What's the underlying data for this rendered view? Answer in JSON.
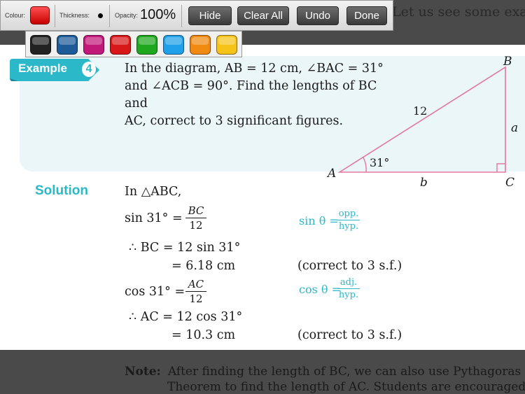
{
  "toolbar": {
    "colour_label": "Colour:",
    "thickness_label": "Thickness:",
    "opacity_label": "Opacity:",
    "opacity_value": "100%",
    "hide_label": "Hide",
    "clear_all_label": "Clear All",
    "undo_label": "Undo",
    "done_label": "Done",
    "selected_colour": "#e00000"
  },
  "palette": [
    {
      "name": "black",
      "color": "#222222"
    },
    {
      "name": "blue",
      "color": "#1d5a98"
    },
    {
      "name": "magenta",
      "color": "#c2187a"
    },
    {
      "name": "red",
      "color": "#d81818"
    },
    {
      "name": "green",
      "color": "#1fa81f"
    },
    {
      "name": "light-blue",
      "color": "#1fa0e8"
    },
    {
      "name": "orange",
      "color": "#f08a10"
    },
    {
      "name": "yellow",
      "color": "#f6c418"
    }
  ],
  "background_text": "Let us see some example",
  "example": {
    "label": "Example",
    "number": "4",
    "line1": "In the diagram, AB = 12 cm, ∠BAC = 31°",
    "line2": "and ∠ACB = 90°. Find the lengths of BC and",
    "line3": "AC, correct to 3 significant figures."
  },
  "diagram": {
    "vertex_a": "A",
    "vertex_b": "B",
    "vertex_c": "C",
    "side_ab": "12",
    "side_bc": "a",
    "side_ac": "b",
    "angle": "31°",
    "line_color": "#e2789e"
  },
  "solution": {
    "label": "Solution",
    "line0": "In △ABC,",
    "sin_lhs": "sin 31° =",
    "sin_num": "BC",
    "sin_den": "12",
    "bc_line": "∴  BC = 12 sin 31°",
    "bc_result": "= 6.18 cm",
    "bc_note": "(correct to 3 s.f.)",
    "cos_lhs": "cos 31° =",
    "cos_num": "AC",
    "cos_den": "12",
    "ac_line": "∴  AC = 12 cos 31°",
    "ac_result": "= 10.3 cm",
    "ac_note": "(correct to 3 s.f.)",
    "hint_sin": "sin θ =",
    "hint_sin_num": "opp.",
    "hint_sin_den": "hyp.",
    "hint_cos": "cos θ =",
    "hint_cos_num": "adj.",
    "hint_cos_den": "hyp."
  },
  "note": {
    "label": "Note:",
    "line1": "After finding the length of BC, we can also use Pythagoras",
    "line2": "Theorem to find the length of AC. Students are encouraged"
  }
}
